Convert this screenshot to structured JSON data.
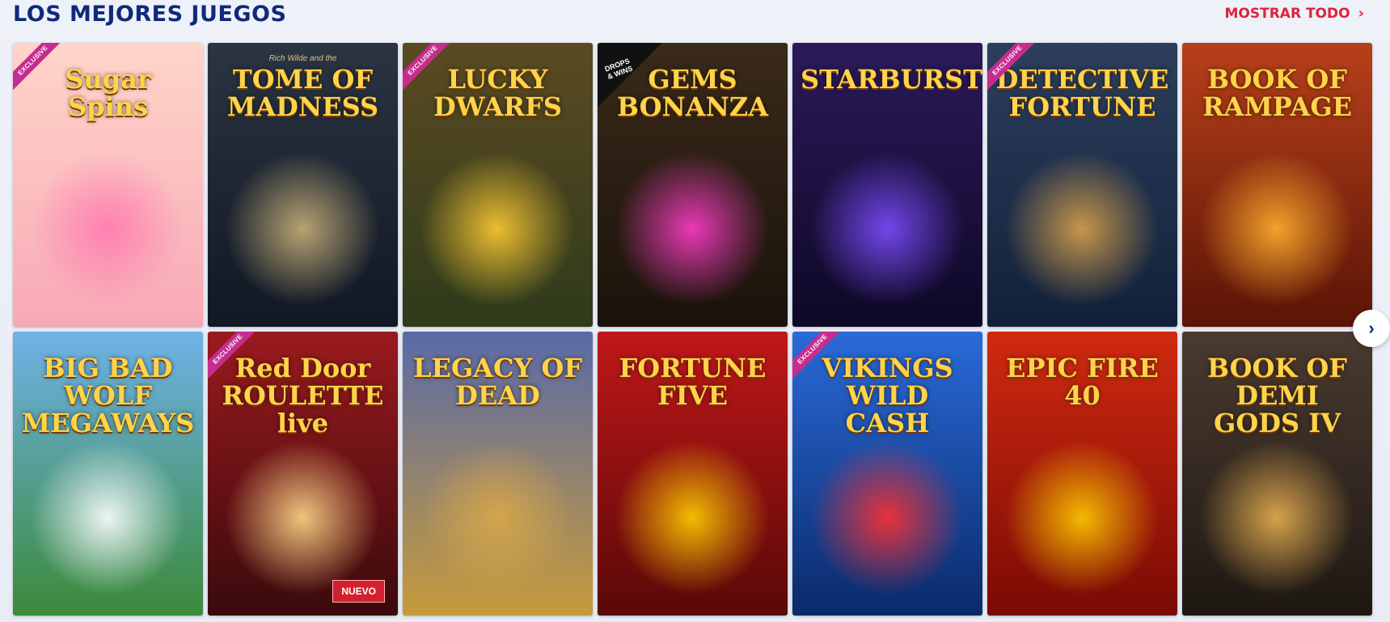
{
  "section": {
    "title": "LOS MEJORES JUEGOS",
    "show_all_label": "MOSTRAR TODO",
    "show_all_icon": "chevron-right-icon",
    "next_icon": "chevron-right-icon"
  },
  "games": [
    {
      "id": "sugar-spins",
      "name": "Sugar Spins",
      "badge": "EXCLUSIVE",
      "bg": [
        "#ffd5c9",
        "#f7a9b6"
      ],
      "accent": "#ff7ab0"
    },
    {
      "id": "tome-of-madness",
      "name": "TOME OF MADNESS",
      "subtitle": "Rich Wilde and the",
      "bg": [
        "#2b3442",
        "#111824"
      ],
      "accent": "#c9b27a"
    },
    {
      "id": "lucky-dwarfs",
      "name": "LUCKY DWARFS",
      "badge": "EXCLUSIVE",
      "bg": [
        "#5b4a22",
        "#2e3b1b"
      ],
      "accent": "#ffcc33"
    },
    {
      "id": "gems-bonanza",
      "name": "GEMS BONANZA",
      "badge_drops": "DROPS & WINS",
      "bg": [
        "#3a2a1a",
        "#1a120a"
      ],
      "accent": "#ff3cc8"
    },
    {
      "id": "starburst",
      "name": "STARBURST",
      "bg": [
        "#2b1a5a",
        "#0e0826"
      ],
      "accent": "#7c4dff"
    },
    {
      "id": "detective-fortune",
      "name": "DETECTIVE FORTUNE",
      "badge": "EXCLUSIVE",
      "bg": [
        "#2d3f5c",
        "#12203a"
      ],
      "accent": "#d8a24a"
    },
    {
      "id": "book-of-rampage",
      "name": "BOOK OF RAMPAGE",
      "bg": [
        "#b8401a",
        "#5a1406"
      ],
      "accent": "#ffb02e"
    },
    {
      "id": "big-bad-wolf",
      "name": "BIG BAD WOLF MEGAWAYS",
      "bg": [
        "#6fb2e8",
        "#3b8a3a"
      ],
      "accent": "#ffffff"
    },
    {
      "id": "red-door-roulette",
      "name": "Red Door ROULETTE live",
      "badge": "EXCLUSIVE",
      "badge_new": "NUEVO",
      "bg": [
        "#9a1a1e",
        "#3a0a0c"
      ],
      "accent": "#ffd98a"
    },
    {
      "id": "legacy-of-dead",
      "name": "LEGACY OF DEAD",
      "bg": [
        "#5a6aa8",
        "#c79b3a"
      ],
      "accent": "#d9a84a"
    },
    {
      "id": "fortune-five",
      "name": "FORTUNE FIVE",
      "bg": [
        "#c01818",
        "#5a0808"
      ],
      "accent": "#ffd000"
    },
    {
      "id": "vikings-wild-cash",
      "name": "VIKINGS WILD CASH",
      "badge": "EXCLUSIVE",
      "bg": [
        "#2a6ad8",
        "#0a2a6a"
      ],
      "accent": "#ff3030"
    },
    {
      "id": "epic-fire-40",
      "name": "EPIC FIRE 40",
      "bg": [
        "#d02a10",
        "#7a0a04"
      ],
      "accent": "#ffcc00"
    },
    {
      "id": "book-of-demi-gods-iv",
      "name": "BOOK OF DEMI GODS IV",
      "bg": [
        "#4a3a30",
        "#1e1812"
      ],
      "accent": "#e8b050"
    }
  ]
}
